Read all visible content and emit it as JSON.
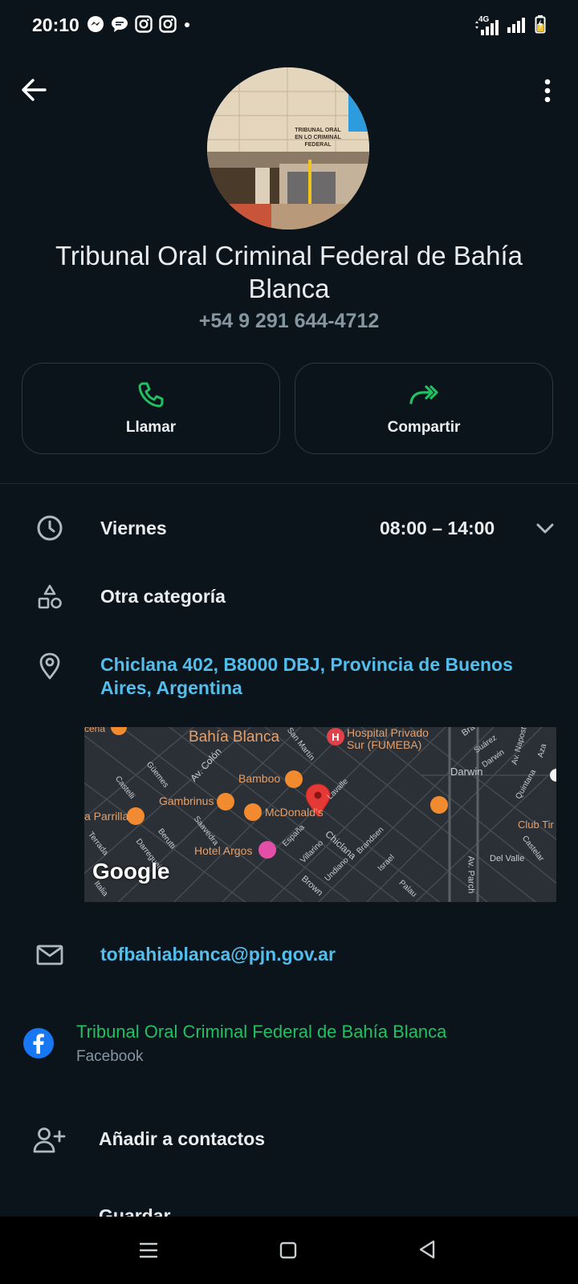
{
  "status_bar": {
    "time": "20:10",
    "notification_icons": [
      "messenger-icon",
      "chat-bubble-icon",
      "instagram-icon",
      "instagram-icon",
      "dot-icon"
    ],
    "network_label": "4G",
    "right_icons": [
      "signal-4g-icon",
      "signal-icon",
      "battery-charging-icon"
    ]
  },
  "header": {
    "back_icon": "arrow-left-icon",
    "menu_icon": "more-vertical-icon"
  },
  "profile": {
    "photo_sign": "TRIBUNAL ORAL EN LO CRIMINAL FEDERAL",
    "name": "Tribunal Oral Criminal Federal de Bahía Blanca",
    "phone": "+54 9 291 644-4712"
  },
  "actions": [
    {
      "label": "Llamar",
      "icon": "phone-icon"
    },
    {
      "label": "Compartir",
      "icon": "share-forward-icon"
    }
  ],
  "hours": {
    "day": "Viernes",
    "time": "08:00 – 14:00"
  },
  "category": "Otra categoría",
  "address": "Chiclana 402, B8000 DBJ, Provincia de Buenos Aires, Argentina",
  "map": {
    "labels": {
      "city": "Bahía Blanca",
      "hospital": "Hospital Privado",
      "hospital2": "Sur (FUMEBA)",
      "bamboo": "Bamboo",
      "gambrinus": "Gambrinus",
      "mcdonalds": "McDonald's",
      "parrilla": "a Parrilla",
      "hotel": "Hotel Argos",
      "darwin": "Darwin",
      "club": "Club Tir",
      "delvalle": "Del Valle",
      "google": "Google",
      "av_colon": "Av. Colón",
      "san_martin": "San Martín",
      "lavalle": "Lavalle",
      "chiclana": "Chiclana",
      "brandsen": "Brandsen",
      "espana": "España",
      "villarino": "Villarino",
      "undiano": "Undiano",
      "israel": "Israel",
      "brown": "Brown",
      "palau": "Palau",
      "saavedra": "Saavedra",
      "berutti": "Berutti",
      "terrada": "Terrada",
      "castelli": "Castelli",
      "guemes": "Güemes",
      "darregueira": "Darregueira",
      "italia": "Italia",
      "av_parch": "Av. Parch",
      "suarez": "Suárez",
      "darwin2": "Darwin",
      "napost": "Av. Napost",
      "quintana": "Quintana",
      "castelar": "Castelar",
      "cena": "cena",
      "bra": "Bra",
      "aza": "Aza"
    }
  },
  "email": "tofbahiablanca@pjn.gov.ar",
  "facebook": {
    "title": "Tribunal Oral Criminal Federal de Bahía Blanca",
    "subtitle": "Facebook"
  },
  "add_contact": "Añadir a contactos",
  "partial_row": "Guardar",
  "colors": {
    "background": "#0b141b",
    "accent_green": "#21c063",
    "link_blue": "#53bdeb",
    "muted": "#8696a0"
  }
}
